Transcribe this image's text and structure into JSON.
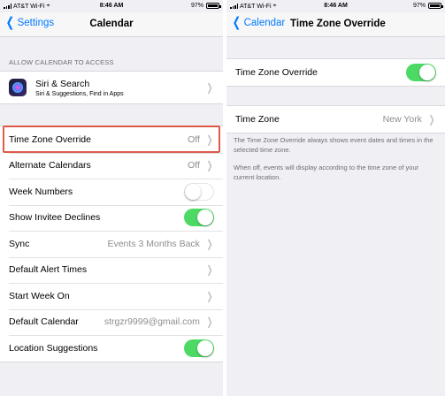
{
  "left": {
    "status": {
      "carrier": "AT&T Wi-Fi",
      "time": "8:46 AM",
      "battery": "97%"
    },
    "nav": {
      "back_label": "Settings",
      "title": "Calendar"
    },
    "section_header": "ALLOW CALENDAR TO ACCESS",
    "siri": {
      "title": "Siri & Search",
      "subtitle": "Siri & Suggestions, Find in Apps"
    },
    "rows": [
      {
        "label": "Time Zone Override",
        "value": "Off",
        "kind": "chevron",
        "highlighted": true
      },
      {
        "label": "Alternate Calendars",
        "value": "Off",
        "kind": "chevron"
      },
      {
        "label": "Week Numbers",
        "kind": "toggle",
        "on": false
      },
      {
        "label": "Show Invitee Declines",
        "kind": "toggle",
        "on": true
      },
      {
        "label": "Sync",
        "value": "Events 3 Months Back",
        "kind": "chevron"
      },
      {
        "label": "Default Alert Times",
        "value": "",
        "kind": "chevron"
      },
      {
        "label": "Start Week On",
        "value": "",
        "kind": "chevron"
      },
      {
        "label": "Default Calendar",
        "value": "strgzr9999@gmail.com",
        "kind": "chevron"
      },
      {
        "label": "Location Suggestions",
        "kind": "toggle",
        "on": true
      }
    ]
  },
  "right": {
    "status": {
      "carrier": "AT&T Wi-Fi",
      "time": "8:46 AM",
      "battery": "97%"
    },
    "nav": {
      "back_label": "Calendar",
      "title": "Time Zone Override"
    },
    "override": {
      "label": "Time Zone Override",
      "on": true
    },
    "time_zone": {
      "label": "Time Zone",
      "value": "New York"
    },
    "footnote_1": "The Time Zone Override always shows event dates and times in the selected time zone.",
    "footnote_2": "When off, events will display according to the time zone of your current location."
  },
  "colors": {
    "accent": "#007aff",
    "toggle_on": "#4cd964",
    "highlight": "#e05a4a"
  }
}
